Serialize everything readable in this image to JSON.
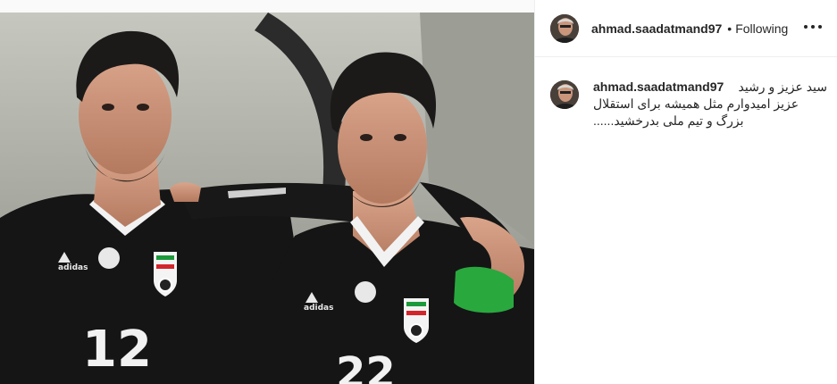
{
  "post": {
    "photo_alt": "",
    "author": {
      "username": "ahmad.saadatmand97",
      "follow_status": "Following",
      "separator": "•"
    },
    "caption": {
      "username": "ahmad.saadatmand97",
      "lines": [
        "سید عزیز و رشید",
        "عزیز امیدوارم مثل همیشه برای استقلال",
        "بزرگ و تیم ملی بدرخشید......"
      ]
    },
    "icons": {
      "more": "more-options-icon",
      "avatar": "profile-avatar"
    },
    "jersey_numbers": {
      "left": "12",
      "right": "22"
    },
    "colors": {
      "text": "#262626",
      "border": "#efefef",
      "background": "#fafafa"
    }
  }
}
